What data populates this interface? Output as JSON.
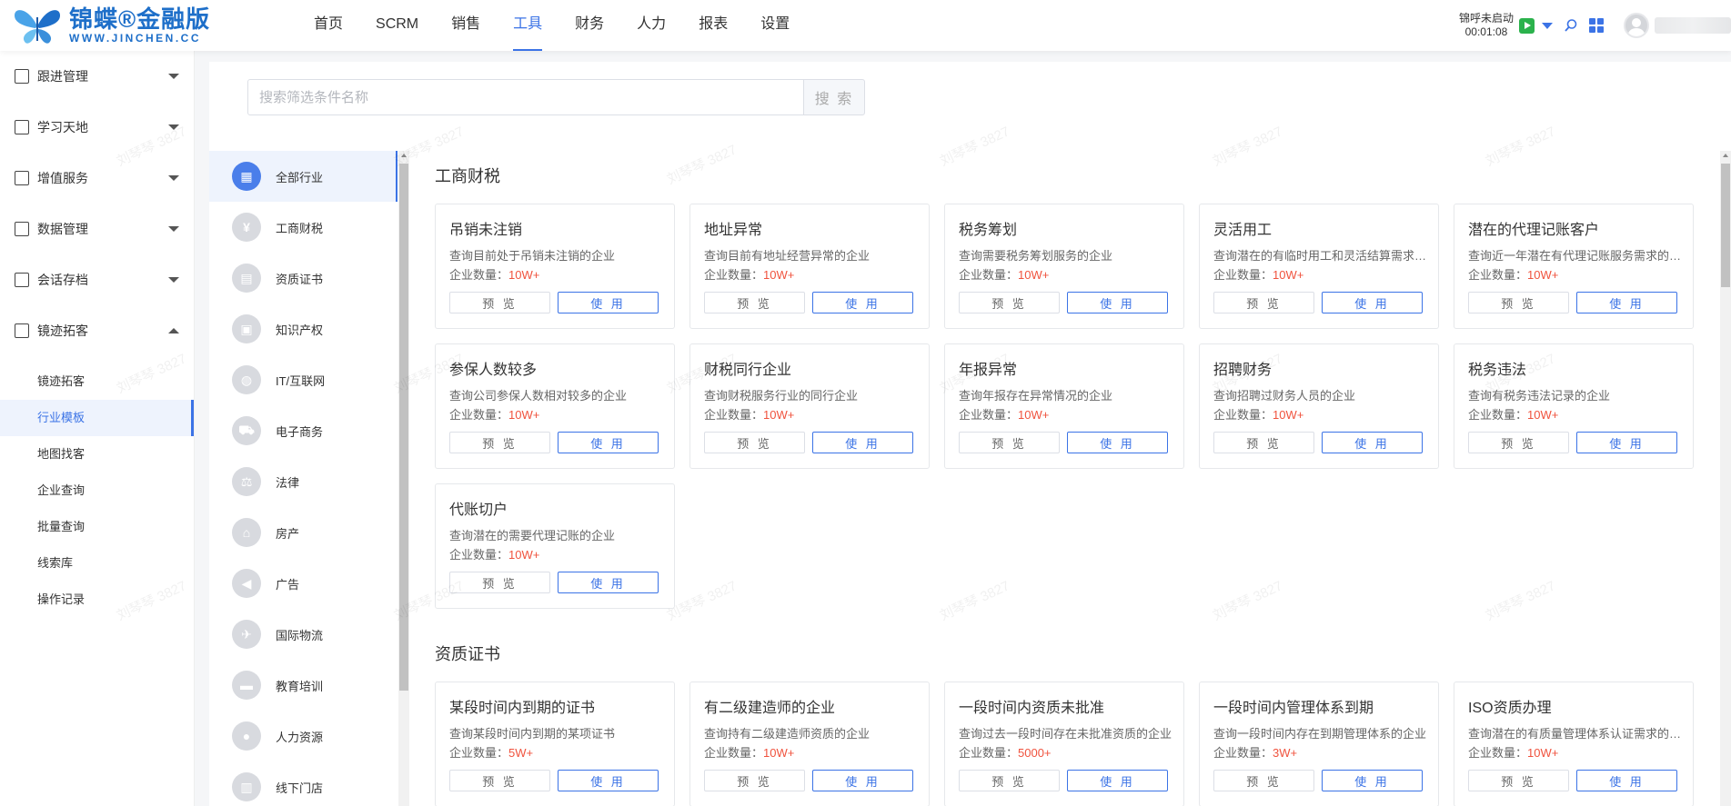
{
  "header": {
    "logo_cn": "锦蝶®金融版",
    "logo_en": "WWW.JINCHEN.CC",
    "nav": [
      {
        "label": "首页",
        "active": false
      },
      {
        "label": "SCRM",
        "active": false
      },
      {
        "label": "销售",
        "active": false
      },
      {
        "label": "工具",
        "active": true
      },
      {
        "label": "财务",
        "active": false
      },
      {
        "label": "人力",
        "active": false
      },
      {
        "label": "报表",
        "active": false
      },
      {
        "label": "设置",
        "active": false
      }
    ],
    "call_status": "锦呼未启动",
    "call_time": "00:01:08"
  },
  "sidebar": {
    "groups": [
      {
        "label": "跟进管理",
        "icon": "clipboard-icon",
        "expanded": false
      },
      {
        "label": "学习天地",
        "icon": "book-icon",
        "expanded": false
      },
      {
        "label": "增值服务",
        "icon": "gift-icon",
        "expanded": false
      },
      {
        "label": "数据管理",
        "icon": "data-icon",
        "expanded": false
      },
      {
        "label": "会话存档",
        "icon": "card-icon",
        "expanded": false
      },
      {
        "label": "镜迹拓客",
        "icon": "person-icon",
        "expanded": true
      }
    ],
    "sub_items": [
      {
        "label": "镜迹拓客",
        "active": false
      },
      {
        "label": "行业模板",
        "active": true
      },
      {
        "label": "地图找客",
        "active": false
      },
      {
        "label": "企业查询",
        "active": false
      },
      {
        "label": "批量查询",
        "active": false
      },
      {
        "label": "线索库",
        "active": false
      },
      {
        "label": "操作记录",
        "active": false
      }
    ]
  },
  "search": {
    "placeholder": "搜索筛选条件名称",
    "button": "搜 索"
  },
  "categories": [
    {
      "label": "全部行业",
      "icon": "grid-icon",
      "glyph": "▦",
      "active": true
    },
    {
      "label": "工商财税",
      "icon": "yen-icon",
      "glyph": "¥",
      "active": false
    },
    {
      "label": "资质证书",
      "icon": "certificate-icon",
      "glyph": "▤",
      "active": false
    },
    {
      "label": "知识产权",
      "icon": "image-icon",
      "glyph": "▣",
      "active": false
    },
    {
      "label": "IT/互联网",
      "icon": "globe-icon",
      "glyph": "◍",
      "active": false
    },
    {
      "label": "电子商务",
      "icon": "cart-icon",
      "glyph": "⛟",
      "active": false
    },
    {
      "label": "法律",
      "icon": "scale-icon",
      "glyph": "⚖",
      "active": false
    },
    {
      "label": "房产",
      "icon": "house-icon",
      "glyph": "⌂",
      "active": false
    },
    {
      "label": "广告",
      "icon": "megaphone-icon",
      "glyph": "◀",
      "active": false
    },
    {
      "label": "国际物流",
      "icon": "plane-icon",
      "glyph": "✈",
      "active": false
    },
    {
      "label": "教育培训",
      "icon": "school-icon",
      "glyph": "▬",
      "active": false
    },
    {
      "label": "人力资源",
      "icon": "user-icon",
      "glyph": "●",
      "active": false
    },
    {
      "label": "线下门店",
      "icon": "store-icon",
      "glyph": "▥",
      "active": false
    }
  ],
  "labels": {
    "count_prefix": "企业数量：",
    "preview": "预 览",
    "use": "使 用"
  },
  "sections": [
    {
      "title": "工商财税",
      "cards": [
        {
          "title": "吊销未注销",
          "desc": "查询目前处于吊销未注销的企业",
          "count": "10W+"
        },
        {
          "title": "地址异常",
          "desc": "查询目前有地址经营异常的企业",
          "count": "10W+"
        },
        {
          "title": "税务筹划",
          "desc": "查询需要税务筹划服务的企业",
          "count": "10W+"
        },
        {
          "title": "灵活用工",
          "desc": "查询潜在的有临时用工和灵活结算需求的企业",
          "count": "10W+"
        },
        {
          "title": "潜在的代理记账客户",
          "desc": "查询近一年潜在有代理记账服务需求的企业",
          "count": "10W+"
        },
        {
          "title": "参保人数较多",
          "desc": "查询公司参保人数相对较多的企业",
          "count": "10W+"
        },
        {
          "title": "财税同行企业",
          "desc": "查询财税服务行业的同行企业",
          "count": "10W+"
        },
        {
          "title": "年报异常",
          "desc": "查询年报存在异常情况的企业",
          "count": "10W+"
        },
        {
          "title": "招聘财务",
          "desc": "查询招聘过财务人员的企业",
          "count": "10W+"
        },
        {
          "title": "税务违法",
          "desc": "查询有税务违法记录的企业",
          "count": "10W+"
        },
        {
          "title": "代账切户",
          "desc": "查询潜在的需要代理记账的企业",
          "count": "10W+"
        }
      ]
    },
    {
      "title": "资质证书",
      "cards": [
        {
          "title": "某段时间内到期的证书",
          "desc": "查询某段时间内到期的某项证书",
          "count": "5W+"
        },
        {
          "title": "有二级建造师的企业",
          "desc": "查询持有二级建造师资质的企业",
          "count": "10W+"
        },
        {
          "title": "一段时间内资质未批准",
          "desc": "查询过去一段时间存在未批准资质的企业",
          "count": "5000+"
        },
        {
          "title": "一段时间内管理体系到期",
          "desc": "查询一段时间内存在到期管理体系的企业",
          "count": "3W+"
        },
        {
          "title": "ISO资质办理",
          "desc": "查询潜在的有质量管理体系认证需求的企业",
          "count": "10W+"
        }
      ]
    }
  ],
  "watermark": "刘琴琴 3827"
}
